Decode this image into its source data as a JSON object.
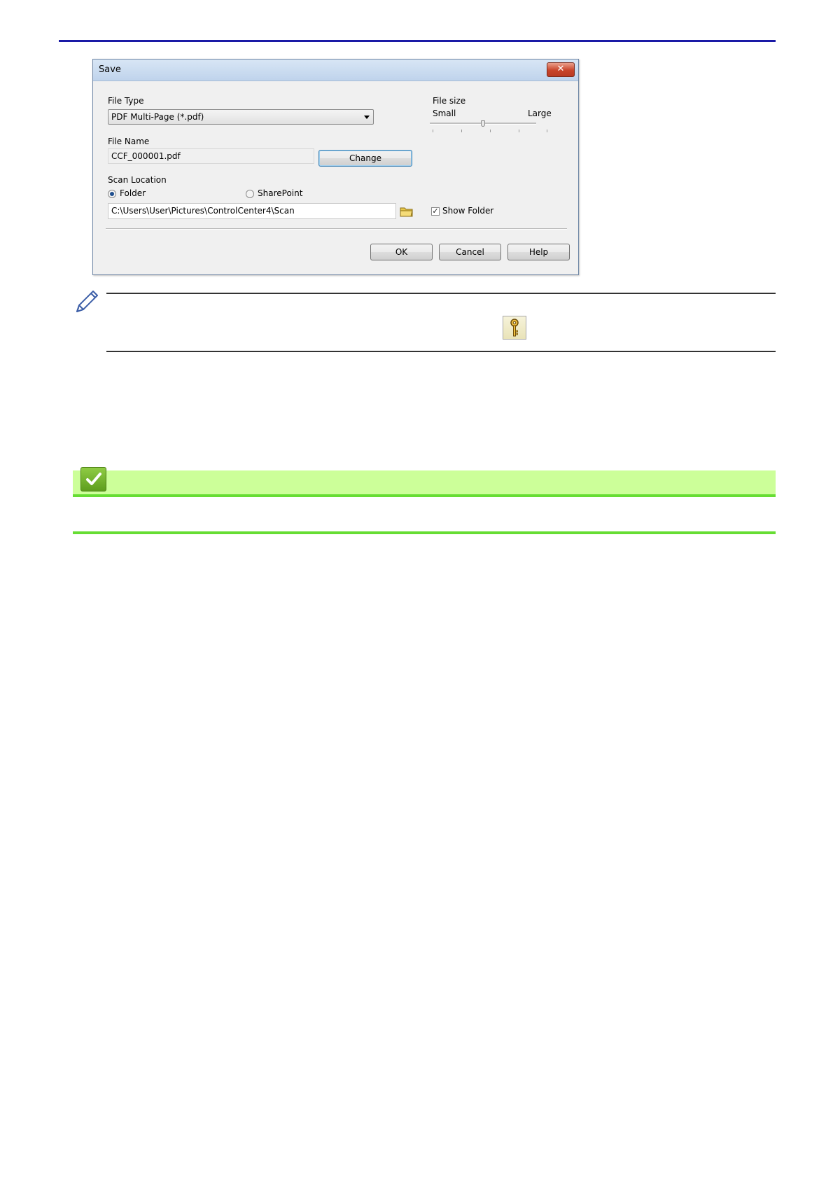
{
  "dialog": {
    "title": "Save",
    "close_label": "✕",
    "file_type": {
      "label": "File Type",
      "selected": "PDF Multi-Page (*.pdf)"
    },
    "file_size": {
      "label": "File size",
      "min_label": "Small",
      "max_label": "Large",
      "slider_value": 0.5
    },
    "file_name": {
      "label": "File Name",
      "value": "CCF_000001.pdf",
      "change_label": "Change"
    },
    "scan_location": {
      "label": "Scan Location",
      "option_folder": "Folder",
      "option_sharepoint": "SharePoint",
      "selected": "Folder",
      "path": "C:\\Users\\User\\Pictures\\ControlCenter4\\Scan",
      "show_folder_label": "Show Folder",
      "show_folder_checked": true
    },
    "buttons": {
      "ok": "OK",
      "cancel": "Cancel",
      "help": "Help"
    }
  },
  "colors": {
    "top_rule": "#1a1aa6",
    "related_bar": "#ccff99",
    "related_line": "#66dd33"
  },
  "icons": [
    "pencil-note-icon",
    "key-icon",
    "checkmark-icon",
    "folder-icon",
    "close-icon"
  ]
}
